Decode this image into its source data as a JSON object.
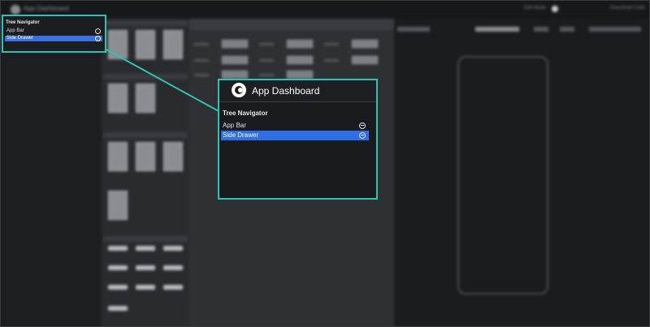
{
  "topbar": {
    "app_title": "App Dashboard",
    "right_label": "Edit Mode",
    "right_link": "Download Code"
  },
  "tree_navigator": {
    "title": "Tree Navigator",
    "items": [
      {
        "label": "App Bar",
        "selected": false,
        "icon": "remove-circle-icon"
      },
      {
        "label": "Side Drawer",
        "selected": true,
        "icon": "remove-circle-icon"
      }
    ]
  },
  "zoom": {
    "app_title": "App Dashboard",
    "title": "Tree Navigator",
    "items": [
      {
        "label": "App Bar",
        "selected": false,
        "icon": "remove-circle-icon"
      },
      {
        "label": "Side Drawer",
        "selected": true,
        "icon": "remove-circle-icon"
      }
    ]
  },
  "colors": {
    "highlight": "#2fc2b2",
    "selection": "#2f6ee5"
  }
}
